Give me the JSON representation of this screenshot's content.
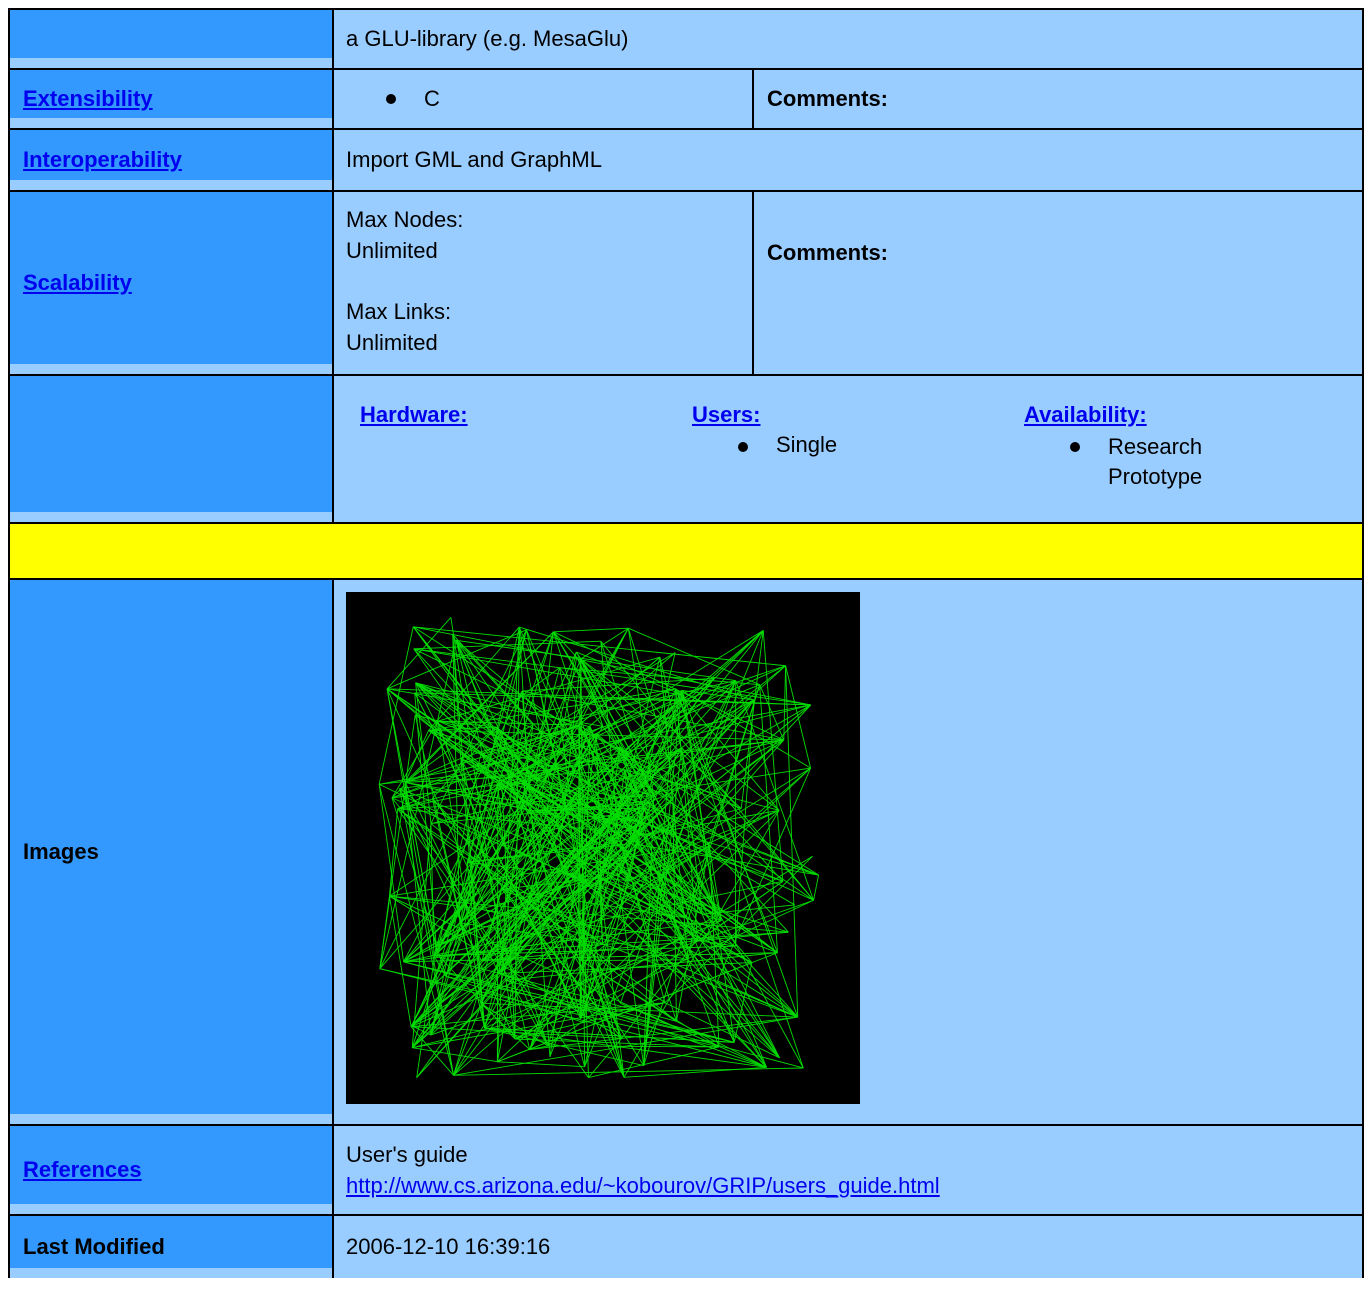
{
  "rows": {
    "requirements": {
      "value": "a GLU-library (e.g. MesaGlu)"
    },
    "extensibility": {
      "label": "Extensibility",
      "items": [
        "C"
      ],
      "comments_label": "Comments:"
    },
    "interoperability": {
      "label": "Interoperability",
      "value": "Import GML and GraphML"
    },
    "scalability": {
      "label": "Scalability",
      "max_nodes_label": "Max Nodes:",
      "max_nodes_value": "Unlimited",
      "max_links_label": "Max Links:",
      "max_links_value": "Unlimited",
      "comments_label": "Comments:"
    },
    "system": {
      "hardware_label": "Hardware:",
      "users_label": "Users:",
      "users_items": [
        "Single"
      ],
      "availability_label": "Availability:",
      "availability_items": [
        "Research Prototype"
      ]
    },
    "images": {
      "label": "Images"
    },
    "references": {
      "label": "References",
      "title": "User's guide",
      "url": "http://www.cs.arizona.edu/~kobourov/GRIP/users_guide.html"
    },
    "last_modified": {
      "label": "Last Modified",
      "value": "2006-12-10 16:39:16"
    }
  },
  "colors": {
    "label_bg": "#3399ff",
    "value_bg": "#99ccff",
    "separator": "#ffff00",
    "graph_edge": "#00dd00",
    "graph_bg": "#000000"
  }
}
